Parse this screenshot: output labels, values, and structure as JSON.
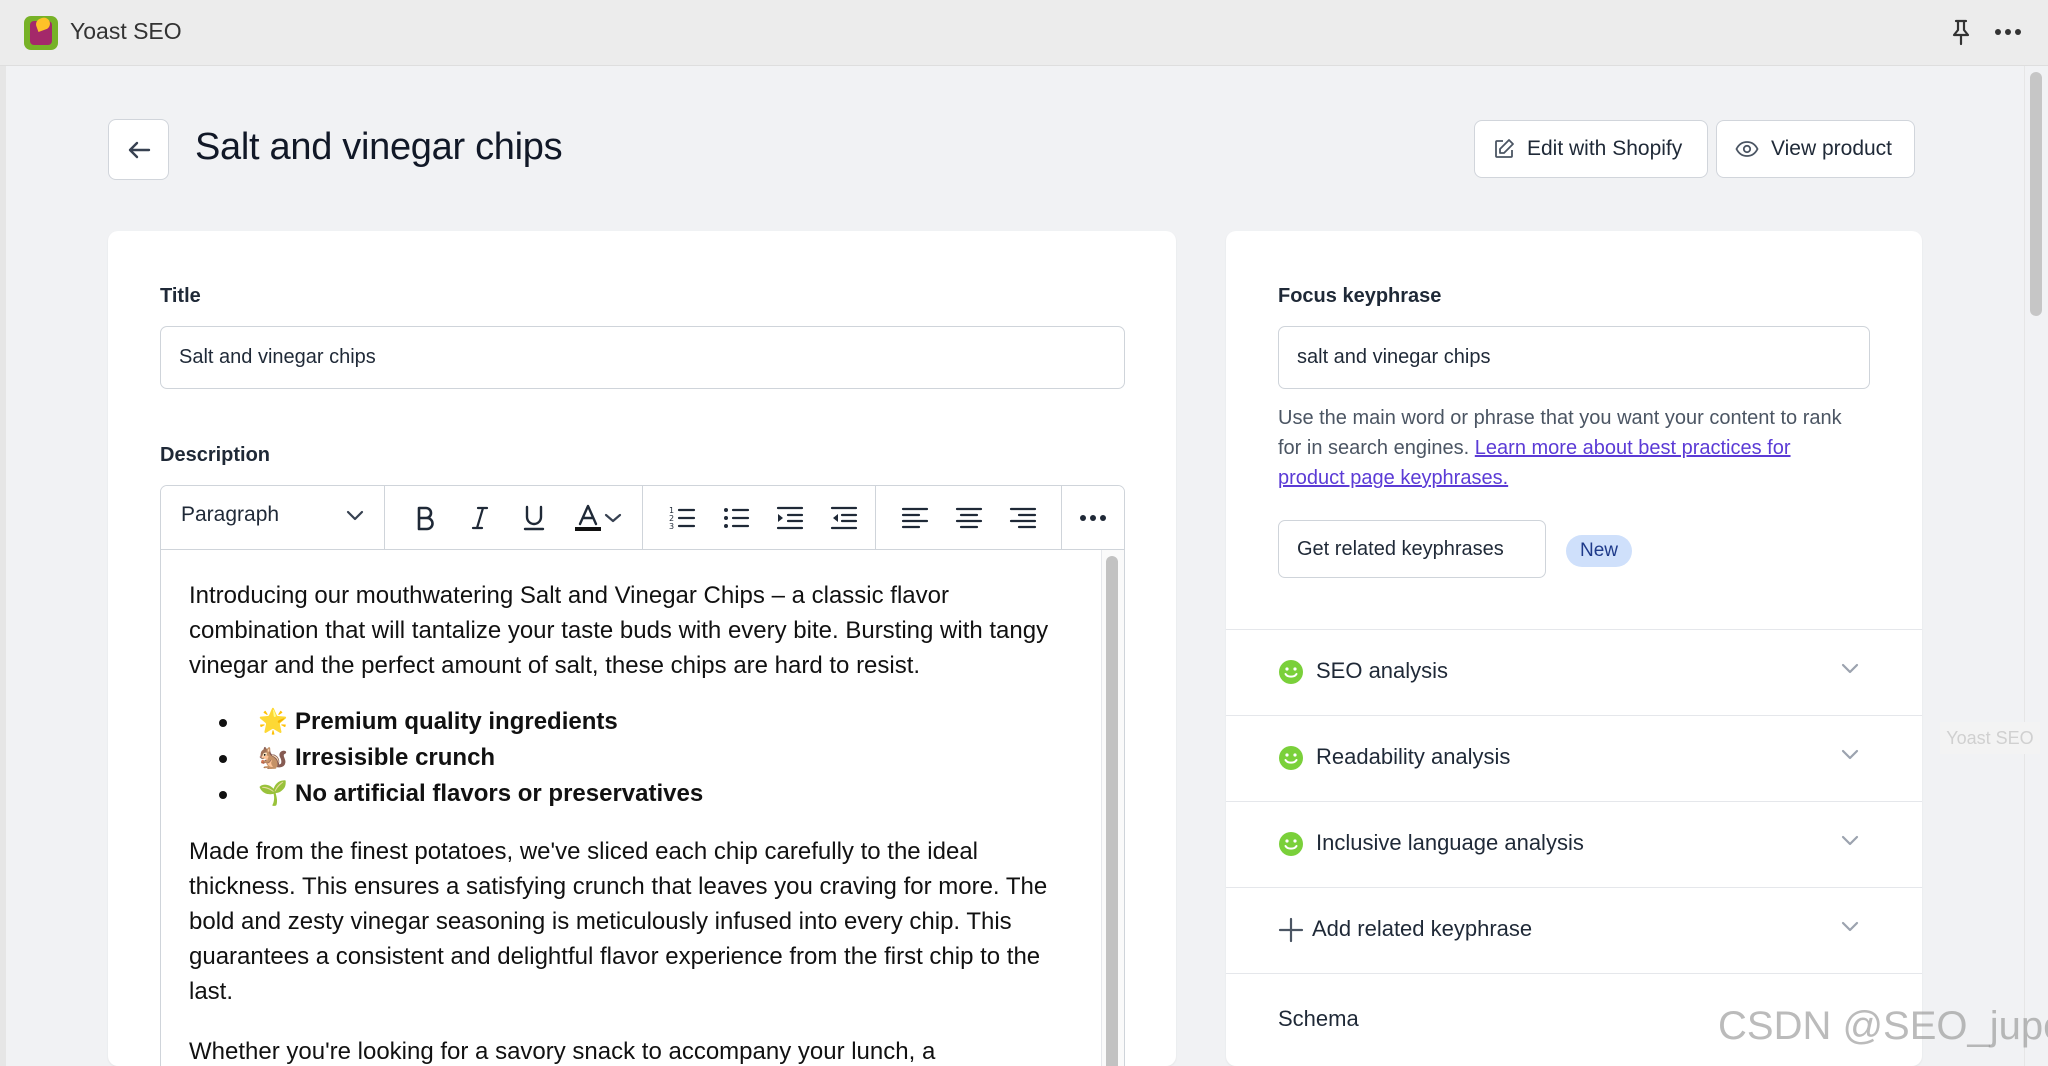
{
  "app": {
    "title": "Yoast SEO",
    "icons": [
      "yoast-logo",
      "pin-icon",
      "more-icon"
    ]
  },
  "header": {
    "page_title": "Salt and vinegar chips",
    "edit_label": "Edit with Shopify",
    "view_label": "View product"
  },
  "left_card": {
    "title_label": "Title",
    "title_value": "Salt and vinegar chips",
    "description_label": "Description",
    "toolbar": {
      "block_format": "Paragraph"
    },
    "body": {
      "intro": "Introducing our mouthwatering Salt and Vinegar Chips – a classic flavor combination that will tantalize your taste buds with every bite. Bursting with tangy vinegar and the perfect amount of salt, these chips are hard to resist.",
      "bullets": [
        {
          "emoji": "🌟",
          "text": "Premium quality ingredients"
        },
        {
          "emoji": "🐿️",
          "text": "Irresisible crunch"
        },
        {
          "emoji": "🌱",
          "text": "No artificial flavors or preservatives"
        }
      ],
      "paragraph2": "Made from the finest potatoes, we've sliced each chip carefully to the ideal thickness. This ensures a satisfying crunch that leaves you craving for more. The bold and zesty vinegar seasoning is meticulously infused into every chip. This guarantees a consistent and delightful flavor experience from the first chip to the last.",
      "paragraph3": "Whether you're looking for a savory snack to accompany your lunch, a"
    }
  },
  "right_card": {
    "focus_label": "Focus keyphrase",
    "focus_value": "salt and vinegar chips",
    "help_text": "Use the main word or phrase that you want your content to rank for in search engines.",
    "help_link": "Learn more about best practices for product page keyphrases.",
    "related_button": "Get related keyphrases",
    "new_badge": "New",
    "accordion": [
      {
        "label": "SEO analysis",
        "status": "good"
      },
      {
        "label": "Readability analysis",
        "status": "good"
      },
      {
        "label": "Inclusive language analysis",
        "status": "good"
      },
      {
        "label": "Add related keyphrase",
        "status": "add"
      }
    ],
    "schema_label": "Schema"
  },
  "overlays": {
    "side_tab": "Yoast SEO",
    "watermark": "CSDN @SEO_juper"
  },
  "colors": {
    "accent_link": "#5b3bd6",
    "good": "#7ad03a",
    "badge_bg": "#cfe0fb"
  }
}
